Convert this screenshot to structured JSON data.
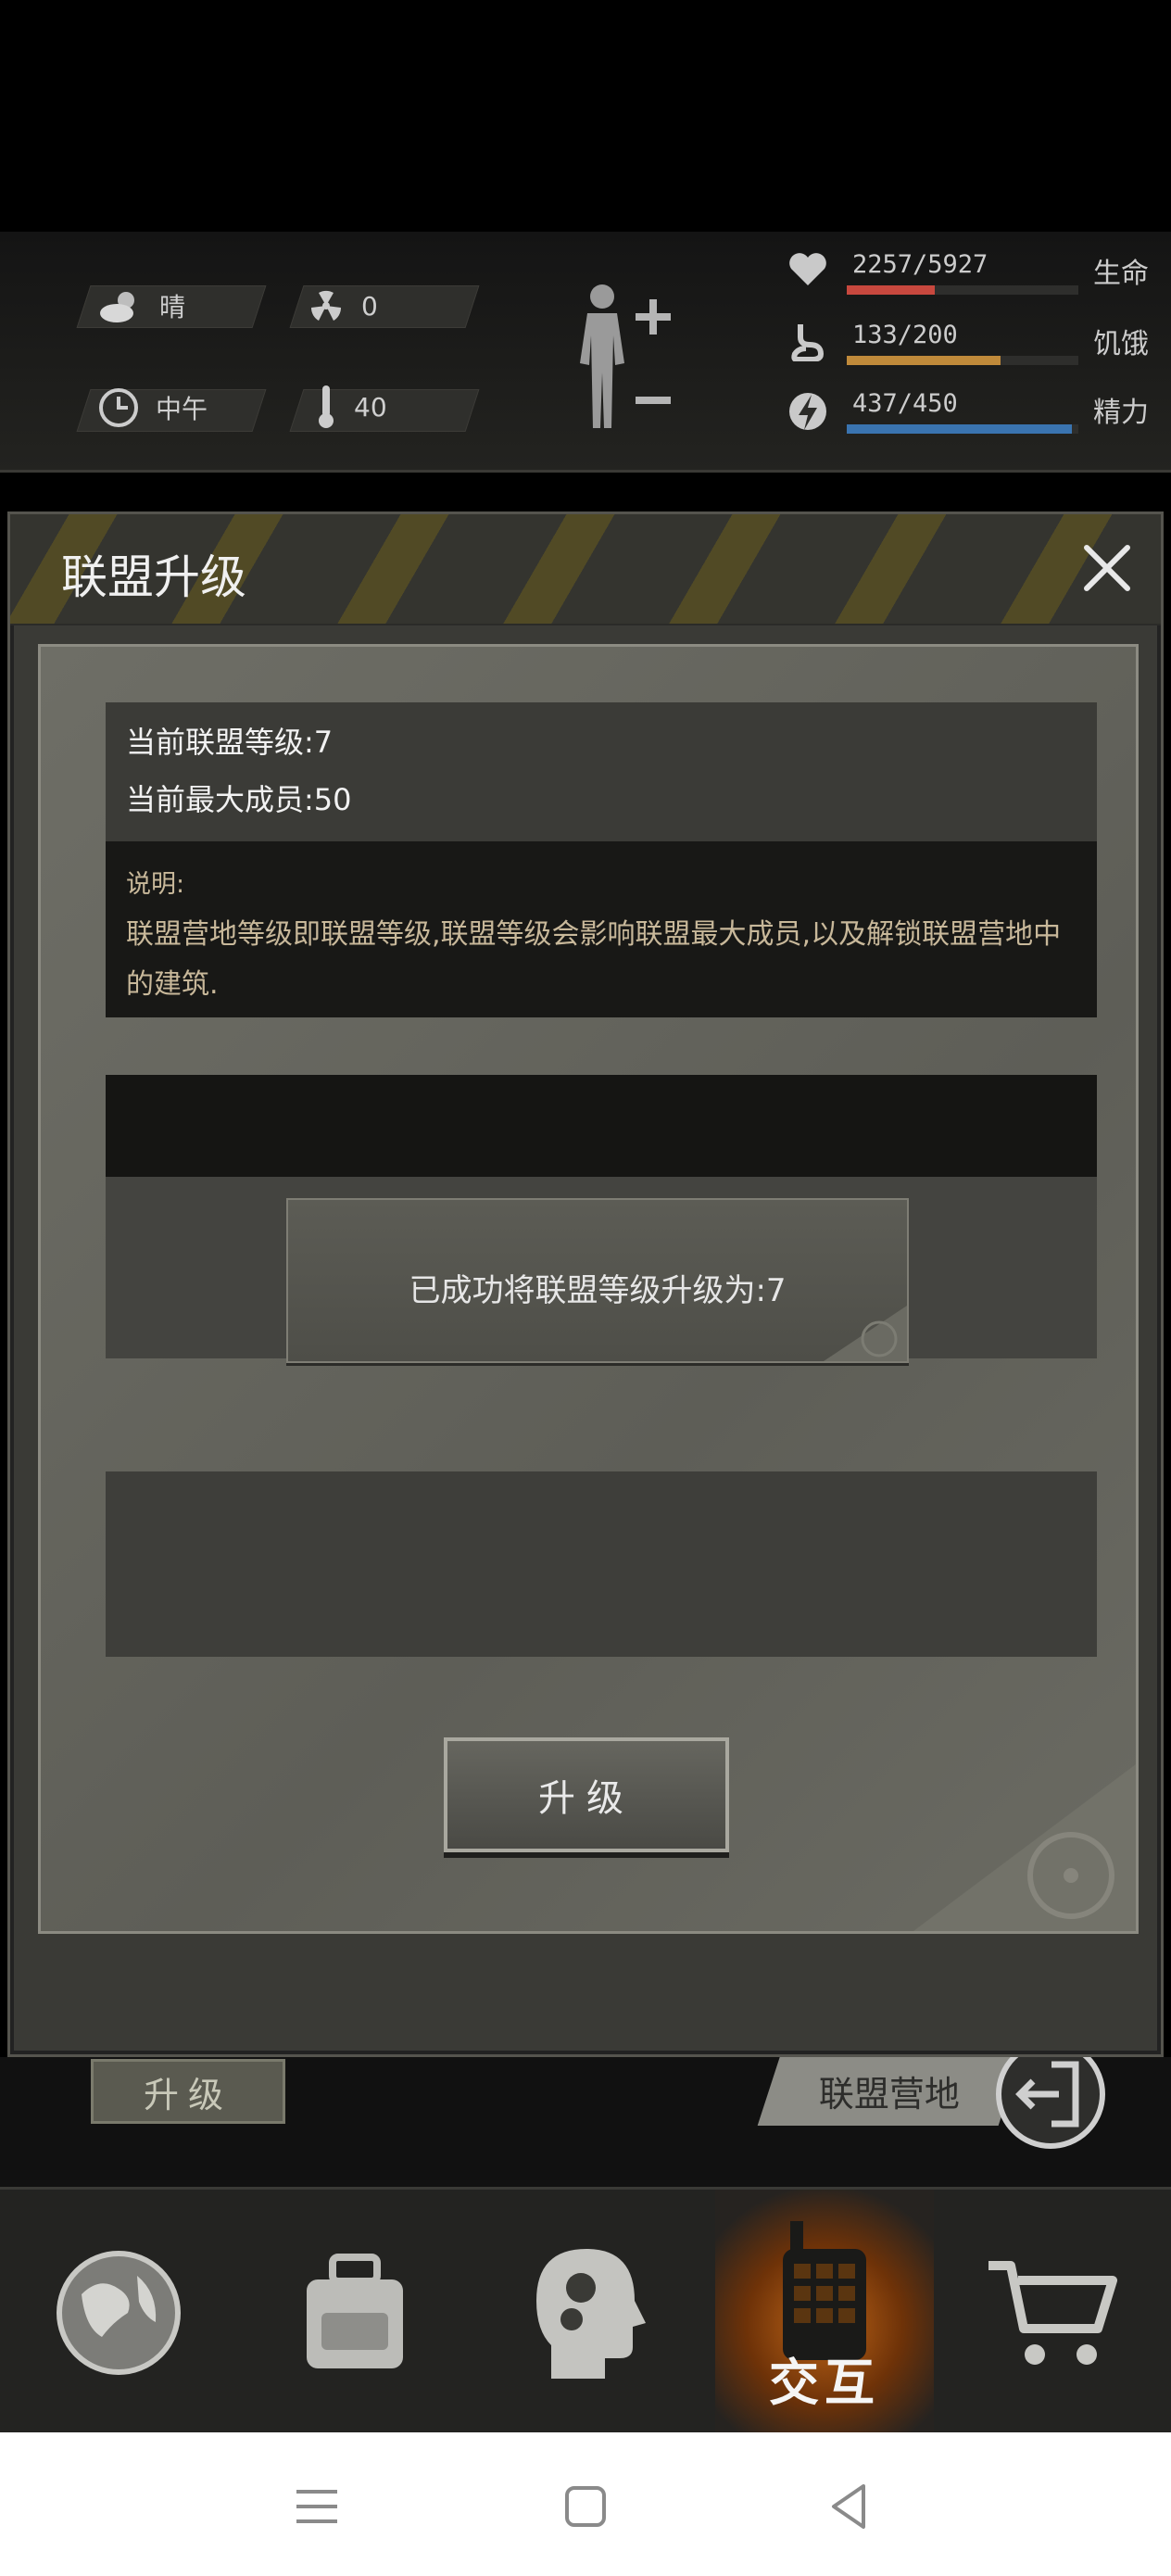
{
  "hud": {
    "weather": "晴",
    "radiation": "0",
    "time": "中午",
    "temperature": "40",
    "health": {
      "value": "2257/5927",
      "label": "生命",
      "fraction": 0.38,
      "color": "#c8483e"
    },
    "hunger": {
      "value": "133/200",
      "label": "饥饿",
      "fraction": 0.665,
      "color": "#c08a3a"
    },
    "energy": {
      "value": "437/450",
      "label": "精力",
      "fraction": 0.97,
      "color": "#3a74b0"
    }
  },
  "dialog": {
    "title": "联盟升级",
    "current_level": "当前联盟等级:7",
    "max_members": "当前最大成员:50",
    "desc_title": "说明:",
    "desc_text": "联盟营地等级即联盟等级,联盟等级会影响联盟最大成员,以及解锁联盟营地中的建筑.",
    "toast": "已成功将联盟等级升级为:7",
    "upgrade_label": "升级"
  },
  "background": {
    "upgrade_label": "升级",
    "camp_label": "联盟营地"
  },
  "bottom_nav": {
    "interact_label": "交互"
  },
  "colors": {
    "accent_orange": "#c06618",
    "hazard_yellow": "#8a7a2c"
  }
}
